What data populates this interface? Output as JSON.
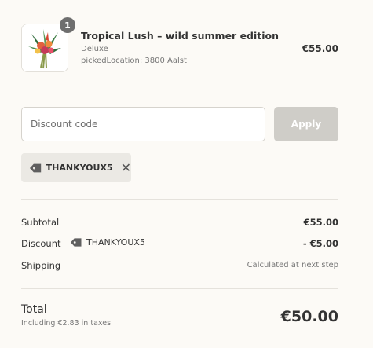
{
  "product": {
    "quantity": "1",
    "title": "Tropical Lush – wild summer edition",
    "variant": "Deluxe",
    "location": "pickedLocation: 3800 Aalst",
    "price": "€55.00"
  },
  "discount": {
    "placeholder": "Discount code",
    "value": "",
    "apply_label": "Apply",
    "applied_code": "THANKYOUX5"
  },
  "summary": {
    "subtotal_label": "Subtotal",
    "subtotal_value": "€55.00",
    "discount_label": "Discount",
    "discount_code": "THANKYOUX5",
    "discount_value": "- €5.00",
    "shipping_label": "Shipping",
    "shipping_value": "Calculated at next step"
  },
  "total": {
    "label": "Total",
    "taxes": "Including €2.83 in taxes",
    "value": "€50.00"
  }
}
